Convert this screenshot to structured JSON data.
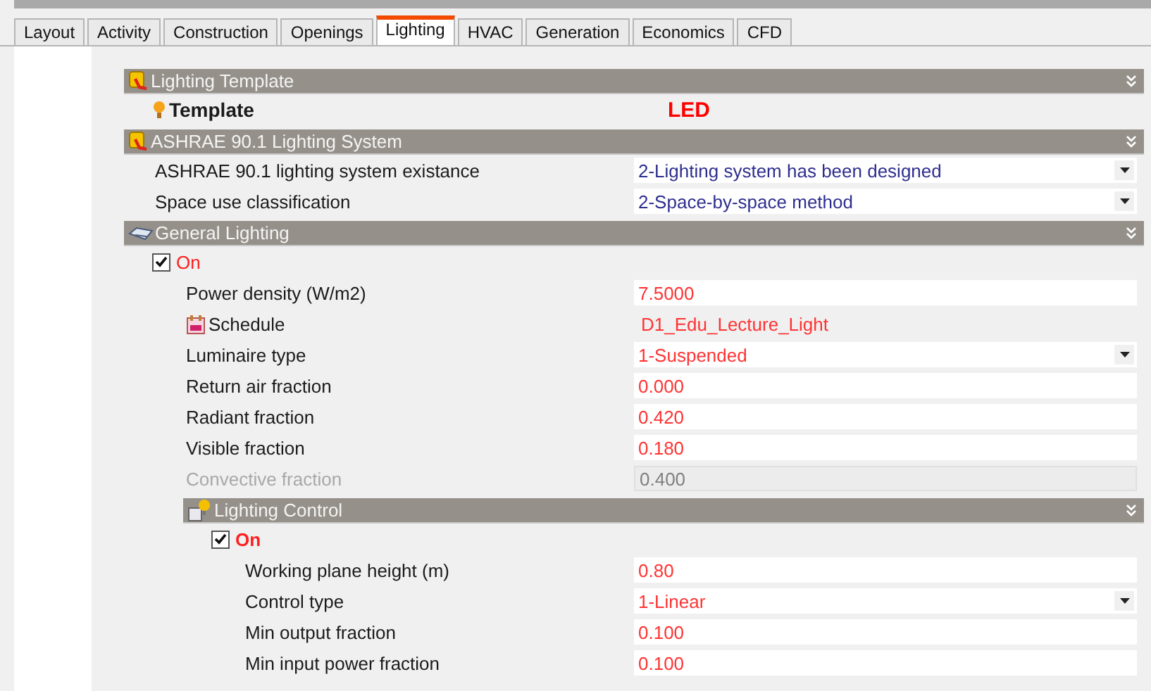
{
  "tabs": [
    {
      "label": "Layout",
      "selected": false
    },
    {
      "label": "Activity",
      "selected": false
    },
    {
      "label": "Construction",
      "selected": false
    },
    {
      "label": "Openings",
      "selected": false
    },
    {
      "label": "Lighting",
      "selected": true
    },
    {
      "label": "HVAC",
      "selected": false
    },
    {
      "label": "Generation",
      "selected": false
    },
    {
      "label": "Economics",
      "selected": false
    },
    {
      "label": "CFD",
      "selected": false
    }
  ],
  "sections": [
    {
      "title": "Lighting Template",
      "rows": [
        {
          "kind": "template",
          "label": "Template",
          "value": "LED",
          "color": "#ff0000"
        }
      ]
    },
    {
      "title": "ASHRAE 90.1 Lighting System",
      "rows": [
        {
          "kind": "dropdown",
          "label": "ASHRAE 90.1 lighting system existance",
          "value": "2-Lighting system has been designed",
          "color": "#2e2e8f"
        },
        {
          "kind": "dropdown",
          "label": "Space use classification",
          "value": "2-Space-by-space method",
          "color": "#2e2e8f"
        }
      ]
    },
    {
      "title": "General Lighting",
      "rows": [
        {
          "kind": "checkbox",
          "label": "On",
          "checked": true,
          "bold": false,
          "children": [
            {
              "kind": "field",
              "label": "Power density (W/m2)",
              "value": "7.5000",
              "color": "#ff3333",
              "disabled": false
            },
            {
              "kind": "schedule",
              "label": "Schedule",
              "value": "D1_Edu_Lecture_Light",
              "color": "#ff3333"
            },
            {
              "kind": "dropdown",
              "label": "Luminaire type",
              "value": "1-Suspended",
              "color": "#ff3333"
            },
            {
              "kind": "field",
              "label": "Return air fraction",
              "value": "0.000",
              "color": "#ff3333",
              "disabled": false
            },
            {
              "kind": "field",
              "label": "Radiant fraction",
              "value": "0.420",
              "color": "#ff3333",
              "disabled": false
            },
            {
              "kind": "field",
              "label": "Visible fraction",
              "value": "0.180",
              "color": "#ff3333",
              "disabled": false
            },
            {
              "kind": "field",
              "label": "Convective fraction",
              "value": "0.400",
              "color": "#808080",
              "disabled": true
            },
            {
              "kind": "section",
              "title": "Lighting Control",
              "rows": [
                {
                  "kind": "checkbox",
                  "label": "On",
                  "checked": true,
                  "bold": true,
                  "children": [
                    {
                      "kind": "field",
                      "label": "Working plane height (m)",
                      "value": "0.80",
                      "color": "#ff3333",
                      "disabled": false
                    },
                    {
                      "kind": "dropdown",
                      "label": "Control type",
                      "value": "1-Linear",
                      "color": "#ff3333"
                    },
                    {
                      "kind": "field",
                      "label": "Min output fraction",
                      "value": "0.100",
                      "color": "#ff3333",
                      "disabled": false
                    },
                    {
                      "kind": "field",
                      "label": "Min input power fraction",
                      "value": "0.100",
                      "color": "#ff3333",
                      "disabled": false
                    }
                  ]
                }
              ]
            }
          ]
        }
      ]
    }
  ]
}
